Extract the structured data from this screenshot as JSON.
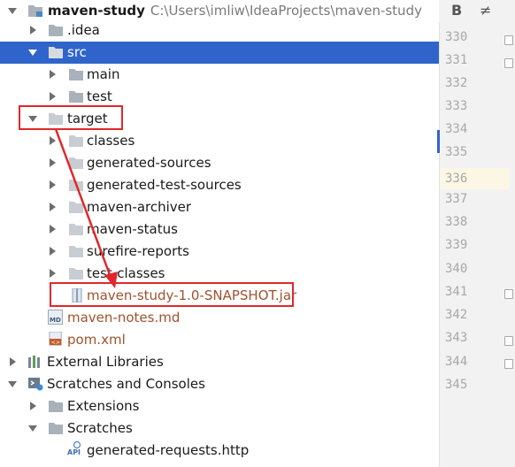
{
  "project_tree": {
    "root": {
      "name": "maven-study",
      "path": "C:\\Users\\imliw\\IdeaProjects\\maven-study"
    },
    "idea": ".idea",
    "src": "src",
    "main": "main",
    "test": "test",
    "target": "target",
    "target_children": [
      "classes",
      "generated-sources",
      "generated-test-sources",
      "maven-archiver",
      "maven-status",
      "surefire-reports",
      "test-classes"
    ],
    "jar": "maven-study-1.0-SNAPSHOT.jar",
    "maven_notes": "maven-notes.md",
    "pom": "pom.xml",
    "external_libraries": "External Libraries",
    "scratches_consoles": "Scratches and Consoles",
    "extensions": "Extensions",
    "scratches": "Scratches",
    "http_file": "generated-requests.http",
    "md_badge": "MD",
    "api_badge": "API"
  },
  "editor": {
    "toolbar": {
      "bold": "B",
      "strike": "≠"
    },
    "line_numbers": [
      "330",
      "331",
      "332",
      "333",
      "334",
      "335",
      "336",
      "337",
      "338",
      "339",
      "340",
      "341",
      "342",
      "343",
      "344",
      "345"
    ],
    "current_line": "336"
  },
  "colors": {
    "selection": "#2f65ca",
    "highlight": "#e0282c",
    "folder": "#a9b1ba"
  }
}
